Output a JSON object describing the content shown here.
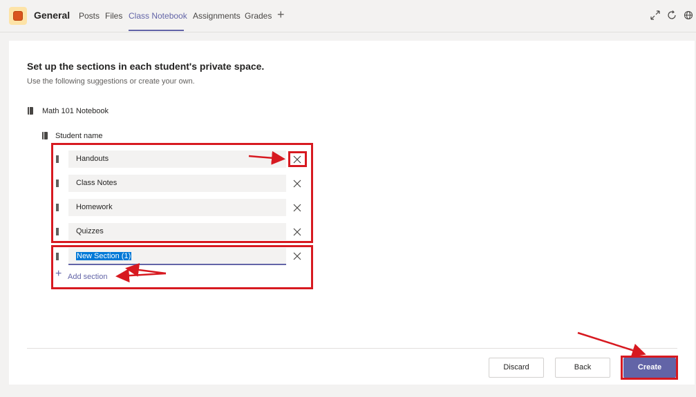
{
  "header": {
    "channel": "General",
    "tabs": [
      {
        "label": "Posts"
      },
      {
        "label": "Files"
      },
      {
        "label": "Class Notebook"
      },
      {
        "label": "Assignments"
      },
      {
        "label": "Grades"
      }
    ],
    "active_tab": "Class Notebook",
    "icons": [
      "expand-icon",
      "refresh-icon",
      "globe-icon"
    ]
  },
  "main": {
    "heading": "Set up the sections in each student's private space.",
    "subheading": "Use the following suggestions or create your own.",
    "notebook_name": "Math 101 Notebook",
    "student_label": "Student name",
    "sections": [
      {
        "label": "Handouts"
      },
      {
        "label": "Class Notes"
      },
      {
        "label": "Homework"
      },
      {
        "label": "Quizzes"
      }
    ],
    "new_section_value": "New Section (1)",
    "add_section_label": "Add section"
  },
  "footer": {
    "discard_label": "Discard",
    "back_label": "Back",
    "create_label": "Create"
  },
  "colors": {
    "accent": "#6264a7",
    "annotation_red": "#d71920"
  }
}
